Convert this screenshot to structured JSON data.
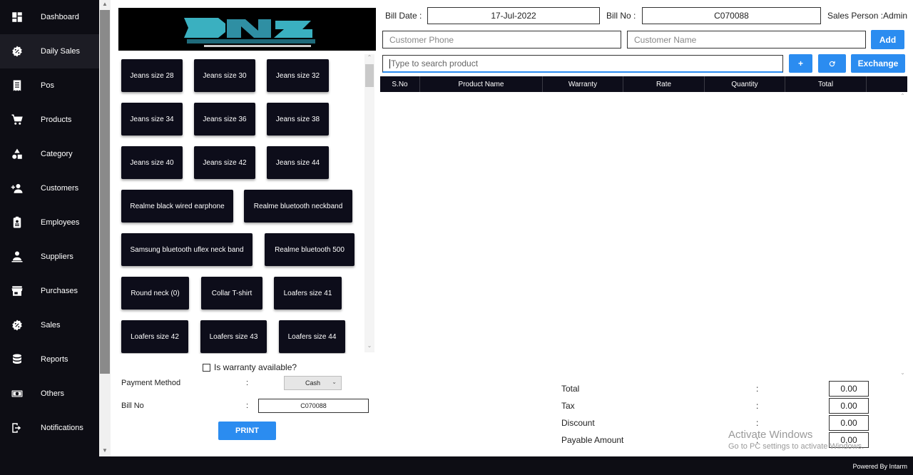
{
  "sidebar": {
    "items": [
      {
        "label": "Dashboard",
        "icon": "dashboard-icon"
      },
      {
        "label": "Daily Sales",
        "icon": "badge-percent-icon"
      },
      {
        "label": "Pos",
        "icon": "receipt-icon"
      },
      {
        "label": "Products",
        "icon": "cart-icon"
      },
      {
        "label": "Category",
        "icon": "shapes-icon"
      },
      {
        "label": "Customers",
        "icon": "add-user-icon"
      },
      {
        "label": "Employees",
        "icon": "id-badge-icon"
      },
      {
        "label": "Suppliers",
        "icon": "person-icon"
      },
      {
        "label": "Purchases",
        "icon": "store-icon"
      },
      {
        "label": "Sales",
        "icon": "badge-percent-icon"
      },
      {
        "label": "Reports",
        "icon": "database-icon"
      },
      {
        "label": "Others",
        "icon": "money-icon"
      },
      {
        "label": "Notifications",
        "icon": "logout-icon"
      }
    ],
    "active_index": 1
  },
  "logo": {
    "text": "DNZ STORE"
  },
  "products": [
    "Jeans size 28",
    "Jeans size 30",
    "Jeans size 32",
    "Jeans size 34",
    "Jeans size 36",
    "Jeans size 38",
    "Jeans size 40",
    "Jeans size 42",
    "Jeans size 44",
    "Realme black wired earphone",
    "Realme bluetooth neckband",
    "Samsung bluetooth uflex neck band",
    "Realme bluetooth 500",
    "Round neck (0)",
    "Collar T-shirt",
    "Loafers size 41",
    "Loafers size 42",
    "Loafers size 43",
    "Loafers size 44"
  ],
  "warranty": {
    "label": "Is warranty available?"
  },
  "payment": {
    "label": "Payment Method",
    "colon": ":",
    "selected": "Cash"
  },
  "bill_left": {
    "label": "Bill No",
    "colon": ":",
    "value": "C070088"
  },
  "print_label": "PRINT",
  "header": {
    "bill_date_label": "Bill Date  :",
    "bill_date": "17-Jul-2022",
    "bill_no_label": "Bill No  :",
    "bill_no": "C070088",
    "sales_person": "Sales Person  :Admin"
  },
  "customer": {
    "phone_placeholder": "Customer Phone",
    "name_placeholder": "Customer Name",
    "add_label": "Add"
  },
  "search": {
    "placeholder": "Type to search product",
    "plus_label": "+",
    "refresh_icon": "refresh-icon",
    "exchange_label": "Exchange"
  },
  "table": {
    "columns": [
      "S.No",
      "Product Name",
      "Warranty",
      "Rate",
      "Quantity",
      "Total"
    ],
    "rows": []
  },
  "totals": {
    "colon": ":",
    "items": [
      {
        "label": "Total",
        "value": "0.00"
      },
      {
        "label": "Tax",
        "value": "0.00"
      },
      {
        "label": "Discount",
        "value": "0.00"
      },
      {
        "label": "Payable Amount",
        "value": "0.00"
      }
    ]
  },
  "watermark": {
    "line1": "Activate Windows",
    "line2": "Go to PC settings to activate Windows."
  },
  "footer": {
    "powered": "Powered By Intarm"
  },
  "colors": {
    "sidebar": "#0d0d14",
    "accent": "#2b8cf0",
    "button_dark": "#0d0d1a"
  }
}
